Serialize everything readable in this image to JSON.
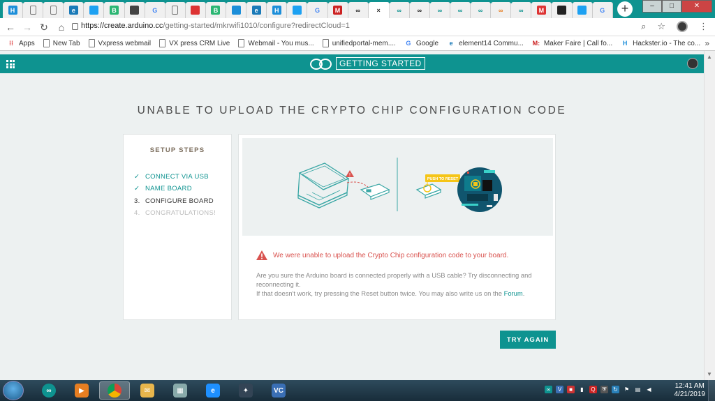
{
  "browser": {
    "url_host": "https://create.arduino.cc",
    "url_path": "/getting-started/mkrwifi1010/configure?redirectCloud=1",
    "tabs": [
      {
        "icon": "hackster-icon",
        "label": "H",
        "color": "#1c8ed9"
      },
      {
        "icon": "page-icon",
        "label": "",
        "color": "#666"
      },
      {
        "icon": "page-icon",
        "label": "",
        "color": "#666"
      },
      {
        "icon": "element14-icon",
        "label": "e",
        "color": "#1a7ab8"
      },
      {
        "icon": "twitter-icon",
        "label": "",
        "color": "#1da1f2"
      },
      {
        "icon": "b-icon",
        "label": "B",
        "color": "#2bb673"
      },
      {
        "icon": "android-icon",
        "label": "",
        "color": "#444"
      },
      {
        "icon": "google-icon",
        "label": "G",
        "color": "#4285f4"
      },
      {
        "icon": "page-icon",
        "label": "",
        "color": "#666"
      },
      {
        "icon": "flag-icon",
        "label": "",
        "color": "#d33"
      },
      {
        "icon": "b-icon",
        "label": "B",
        "color": "#2bb673"
      },
      {
        "icon": "globe-icon",
        "label": "",
        "color": "#1c8ed9"
      },
      {
        "icon": "element14-icon",
        "label": "e",
        "color": "#1a7ab8"
      },
      {
        "icon": "hackster-icon",
        "label": "H",
        "color": "#1c8ed9"
      },
      {
        "icon": "twitter-icon",
        "label": "",
        "color": "#1da1f2"
      },
      {
        "icon": "google-icon",
        "label": "G",
        "color": "#4285f4"
      },
      {
        "icon": "makerfaire-icon",
        "label": "M",
        "color": "#c22"
      },
      {
        "icon": "arduino-icon",
        "label": "∞",
        "color": "#222"
      },
      {
        "icon": "close-icon",
        "label": "×",
        "color": "#333"
      },
      {
        "icon": "arduino-icon",
        "label": "∞",
        "color": "#0e9390"
      },
      {
        "icon": "arduino-icon",
        "label": "∞",
        "color": "#222"
      },
      {
        "icon": "arduino-icon",
        "label": "∞",
        "color": "#0e9390"
      },
      {
        "icon": "arduino-icon",
        "label": "∞",
        "color": "#0e9390"
      },
      {
        "icon": "arduino-icon",
        "label": "∞",
        "color": "#0e9390"
      },
      {
        "icon": "arduino-icon",
        "label": "∞",
        "color": "#e67e22"
      },
      {
        "icon": "arduino-icon",
        "label": "∞",
        "color": "#0e9390"
      },
      {
        "icon": "gmail-icon",
        "label": "M",
        "color": "#d33"
      },
      {
        "icon": "github-icon",
        "label": "",
        "color": "#222"
      },
      {
        "icon": "twitter-icon",
        "label": "",
        "color": "#1da1f2"
      },
      {
        "icon": "google-icon",
        "label": "G",
        "color": "#4285f4"
      }
    ],
    "bookmarks": [
      {
        "label": "Apps",
        "icon": "apps-icon"
      },
      {
        "label": "New Tab",
        "icon": "page-icon"
      },
      {
        "label": "Vxpress webmail",
        "icon": "page-icon"
      },
      {
        "label": "VX press CRM Live",
        "icon": "page-icon"
      },
      {
        "label": "Webmail - You mus...",
        "icon": "page-icon"
      },
      {
        "label": "unifiedportal-mem....",
        "icon": "page-icon"
      },
      {
        "label": "Google",
        "icon": "google-icon"
      },
      {
        "label": "element14 Commu...",
        "icon": "element14-icon"
      },
      {
        "label": "Maker Faire | Call fo...",
        "icon": "makerfaire-icon"
      },
      {
        "label": "Hackster.io - The co...",
        "icon": "hackster-icon"
      }
    ],
    "bookmarks_more": "»"
  },
  "appbar": {
    "brand": "GETTING STARTED"
  },
  "page": {
    "title": "UNABLE TO UPLOAD THE CRYPTO CHIP CONFIGURATION CODE",
    "steps_heading": "SETUP STEPS",
    "steps": [
      {
        "marker": "✓",
        "label": "CONNECT VIA USB",
        "state": "done"
      },
      {
        "marker": "✓",
        "label": "NAME BOARD",
        "state": "done"
      },
      {
        "marker": "3.",
        "label": "CONFIGURE BOARD",
        "state": "current"
      },
      {
        "marker": "4.",
        "label": "CONGRATULATIONS!",
        "state": "future"
      }
    ],
    "illustration_label": "PUSH TO RESET",
    "error_message": "We were unable to upload the Crypto Chip configuration code to your board.",
    "help_line1": "Are you sure the Arduino board is connected properly with a USB cable? Try disconnecting and reconnecting it.",
    "help_line2": "If that doesn't work, try pressing the Reset button twice. You may also write us on the",
    "forum_link": "Forum",
    "help_end": ".",
    "try_again": "TRY AGAIN"
  },
  "taskbar": {
    "apps": [
      {
        "icon": "arduino-icon",
        "label": "∞",
        "color": "#0e9390"
      },
      {
        "icon": "media-player-icon",
        "label": "▶",
        "color": "#e67e22"
      },
      {
        "icon": "chrome-icon",
        "label": "",
        "color": "#db4437"
      },
      {
        "icon": "outlook-icon",
        "label": "✉",
        "color": "#e8b64c"
      },
      {
        "icon": "calculator-icon",
        "label": "▦",
        "color": "#8aa"
      },
      {
        "icon": "ie-icon",
        "label": "e",
        "color": "#1e90ff"
      },
      {
        "icon": "bird-icon",
        "label": "✦",
        "color": "#345"
      },
      {
        "icon": "vscode-icon",
        "label": "VC",
        "color": "#3a6fb5"
      }
    ],
    "time": "12:41 AM",
    "date": "4/21/2019"
  }
}
